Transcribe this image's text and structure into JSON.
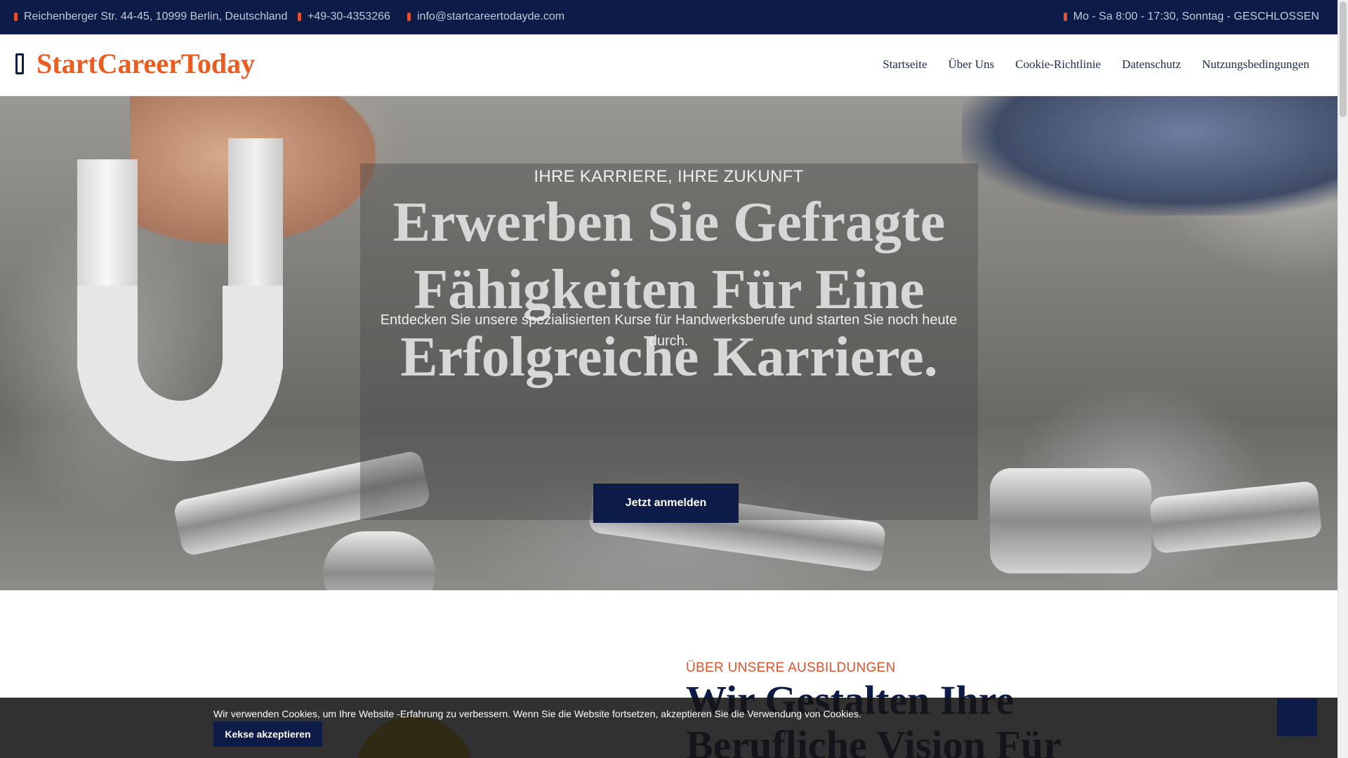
{
  "topbar": {
    "address": "Reichenberger Str. 44-45, 10999 Berlin, Deutschland",
    "phone": "+49-30-4353266",
    "email": "info@startcareertodayde.com",
    "hours": "Mo - Sa 8:00 - 17:30, Sonntag - GESCHLOSSEN",
    "icons": [
      "map-marker-icon",
      "phone-icon",
      "envelope-icon",
      "clock-icon"
    ],
    "accent_color": "#e2522a"
  },
  "brand": {
    "name": "StartCareerToday",
    "color": "#ee5b1e",
    "icon": "brand-icon"
  },
  "nav": {
    "items": [
      {
        "label": "Startseite"
      },
      {
        "label": "Über Uns"
      },
      {
        "label": "Cookie-Richtlinie"
      },
      {
        "label": "Datenschutz"
      },
      {
        "label": "Nutzungsbedingungen"
      }
    ]
  },
  "hero": {
    "eyebrow": "IHRE KARRIERE, IHRE ZUKUNFT",
    "headline": "Erwerben Sie Gefragte Fähigkeiten Für Eine Erfolgreiche Karriere.",
    "lead": "Entdecken Sie unsere spezialisierten Kurse für Handwerksberufe und starten Sie noch heute durch.",
    "cta_label": "Jetzt anmelden"
  },
  "about": {
    "eyebrow": "ÜBER UNSERE AUSBILDUNGEN",
    "title": "Wir Gestalten Ihre Berufliche Vision Für"
  },
  "cookie": {
    "text": "Wir verwenden Cookies, um Ihre Website -Erfahrung zu verbessern. Wenn Sie die Website fortsetzen, akzeptieren Sie die Verwendung von Cookies.",
    "button_label": "Kekse akzeptieren"
  },
  "colors": {
    "primary": "#0c1b47",
    "accent": "#e2522a"
  }
}
